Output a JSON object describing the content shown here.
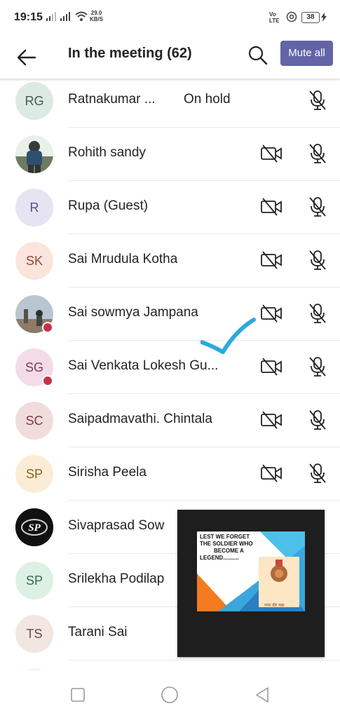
{
  "status_bar": {
    "time": "19:15",
    "speed_value": "29.0",
    "speed_unit": "KB/S",
    "volte_top": "Vo",
    "volte_bottom": "LTE",
    "battery": "38"
  },
  "header": {
    "title": "In the meeting (62)",
    "mute_all_label": "Mute all",
    "accent": "#6264a7"
  },
  "participants": [
    {
      "initials": "RG",
      "name": "Ratnakumar ...",
      "status": "On hold",
      "avatar_bg": "#dcebe1",
      "avatar_color": "#4a5a4f"
    },
    {
      "initials": "",
      "name": "Rohith sandy",
      "status": "",
      "avatar_bg": "#cfd8cf",
      "avatar_color": "#333"
    },
    {
      "initials": "R",
      "name": "Rupa (Guest)",
      "status": "",
      "avatar_bg": "#e6e3f3",
      "avatar_color": "#545080"
    },
    {
      "initials": "SK",
      "name": "Sai Mrudula Kotha",
      "status": "",
      "avatar_bg": "#fbe4dc",
      "avatar_color": "#8a4a3a"
    },
    {
      "initials": "",
      "name": "Sai sowmya Jampana",
      "status": "",
      "avatar_bg": "#d9d4cf",
      "avatar_color": "#333"
    },
    {
      "initials": "SG",
      "name": "Sai Venkata Lokesh Gu...",
      "status": "",
      "avatar_bg": "#f3dbe8",
      "avatar_color": "#7b3d5f"
    },
    {
      "initials": "SC",
      "name": "Saipadmavathi. Chintala",
      "status": "",
      "avatar_bg": "#f1dcdc",
      "avatar_color": "#7a3c3c"
    },
    {
      "initials": "SP",
      "name": "Sirisha Peela",
      "status": "",
      "avatar_bg": "#fbedd5",
      "avatar_color": "#8a6224"
    },
    {
      "initials": "",
      "name": "Sivaprasad  Sow",
      "status": "",
      "avatar_bg": "#111111",
      "avatar_color": "#ffffff"
    },
    {
      "initials": "SP",
      "name": "Srilekha Podilap",
      "status": "",
      "avatar_bg": "#dcf0e3",
      "avatar_color": "#356b47"
    },
    {
      "initials": "TS",
      "name": "Tarani Sai",
      "status": "",
      "avatar_bg": "#f1e6e1",
      "avatar_color": "#6b4b3e"
    }
  ],
  "presentation": {
    "line1": "LEST WE FORGET",
    "line2": "THE SOLDIER WHO",
    "line3": "BECOME A",
    "line4": "LEGEND..........",
    "hindi": "परम वीर चक्र"
  }
}
